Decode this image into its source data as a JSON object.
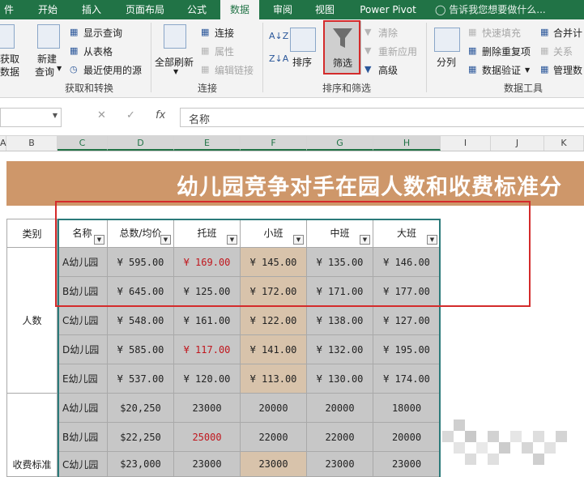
{
  "ribbon": {
    "tabs": [
      "件",
      "开始",
      "插入",
      "页面布局",
      "公式",
      "数据",
      "审阅",
      "视图",
      "Power Pivot"
    ],
    "active_tab": "数据",
    "tell_me": "告诉我您想要做什么...",
    "get_data": [
      "获取",
      "数据"
    ],
    "new_query": [
      "新建",
      "查询"
    ],
    "show_queries": "显示查询",
    "from_table": "从表格",
    "recent_sources": "最近使用的源",
    "group_get_transform": "获取和转换",
    "refresh_all": "全部刷新",
    "connections": "连接",
    "properties": "属性",
    "edit_links": "编辑链接",
    "group_connections": "连接",
    "sort": "排序",
    "filter": "筛选",
    "clear": "清除",
    "reapply": "重新应用",
    "advanced": "高级",
    "group_sort_filter": "排序和筛选",
    "text_to_columns": "分列",
    "flash_fill": "快速填充",
    "remove_duplicates": "删除重复项",
    "data_validation": "数据验证",
    "group_data_tools": "数据工具",
    "consolidate": "合并计",
    "relationships": "关系",
    "manage": "管理数"
  },
  "formula_bar": {
    "name_box": "",
    "fx": "fx",
    "content": "名称"
  },
  "columns": [
    "A",
    "B",
    "C",
    "D",
    "E",
    "F",
    "G",
    "H",
    "I",
    "J",
    "K"
  ],
  "title": "幼儿园竞争对手在园人数和收费标准分",
  "table": {
    "headers": [
      "类别",
      "名称",
      "总数/均价",
      "托班",
      "小班",
      "中班",
      "大班"
    ],
    "categories": [
      "人数",
      "收费标准"
    ],
    "rows": [
      [
        "A幼儿园",
        "¥ 595.00",
        "¥ 169.00",
        "¥ 145.00",
        "¥ 135.00",
        "¥ 146.00"
      ],
      [
        "B幼儿园",
        "¥ 645.00",
        "¥ 125.00",
        "¥ 172.00",
        "¥ 171.00",
        "¥ 177.00"
      ],
      [
        "C幼儿园",
        "¥ 548.00",
        "¥ 161.00",
        "¥ 122.00",
        "¥ 138.00",
        "¥ 127.00"
      ],
      [
        "D幼儿园",
        "¥ 585.00",
        "¥ 117.00",
        "¥ 141.00",
        "¥ 132.00",
        "¥ 195.00"
      ],
      [
        "E幼儿园",
        "¥ 537.00",
        "¥ 120.00",
        "¥ 113.00",
        "¥ 130.00",
        "¥ 174.00"
      ],
      [
        "A幼儿园",
        "$20,250",
        "23000",
        "20000",
        "20000",
        "18000"
      ],
      [
        "B幼儿园",
        "$22,250",
        "25000",
        "22000",
        "22000",
        "20000"
      ],
      [
        "C幼儿园",
        "$23,000",
        "23000",
        "23000",
        "23000",
        "23000"
      ]
    ]
  },
  "colors": {
    "excel_green": "#217346",
    "title_band": "#ce976a",
    "cell_gray": "#c7c7c7",
    "cell_beige": "#d8c3ab",
    "highlight_red": "#d42b2b",
    "value_red": "#c0161d"
  }
}
